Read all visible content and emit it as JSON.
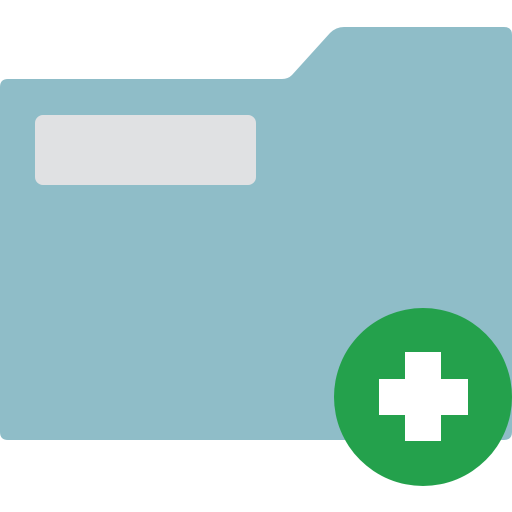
{
  "icon": {
    "name": "add-folder-icon",
    "parts": {
      "folder": "folder-icon",
      "label": "folder-label-placeholder",
      "badge": "plus-icon"
    }
  },
  "colors": {
    "background": "#ffffff",
    "folder": "#8fbdc8",
    "label": "#e0e1e3",
    "badge": "#24a14c",
    "plus": "#ffffff"
  }
}
